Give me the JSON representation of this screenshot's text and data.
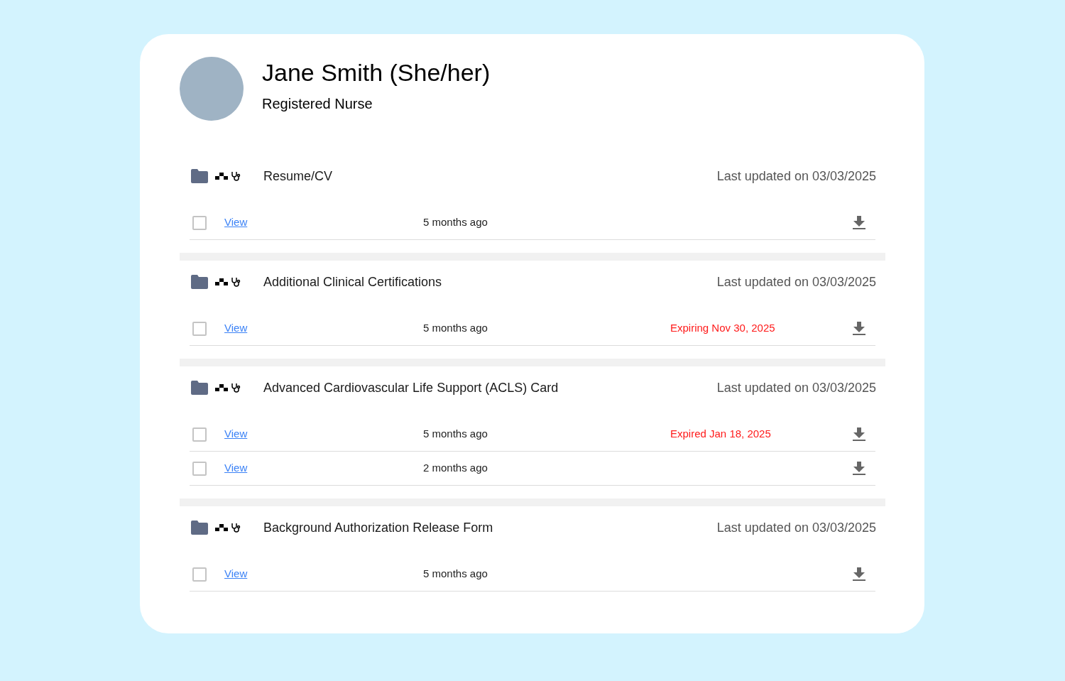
{
  "profile": {
    "name": "Jane Smith (She/her)",
    "title": "Registered Nurse"
  },
  "sections": [
    {
      "title": "Resume/CV",
      "updated": "Last updated on 03/03/2025",
      "files": [
        {
          "checked": false,
          "link": "View",
          "age": "5 months ago"
        }
      ]
    },
    {
      "title": "Additional Clinical Certifications",
      "updated": "Last updated on 03/03/2025",
      "files": [
        {
          "checked": false,
          "link": "View",
          "age": "5 months ago",
          "status": "Expiring Nov 30, 2025"
        }
      ]
    },
    {
      "title": "Advanced Cardiovascular Life Support (ACLS) Card",
      "updated": "Last updated on 03/03/2025",
      "files": [
        {
          "checked": false,
          "link": "View",
          "age": "5 months ago",
          "status": "Expired Jan 18, 2025"
        },
        {
          "checked": false,
          "link": "View",
          "age": "2 months ago"
        }
      ]
    },
    {
      "title": "Background Authorization Release Form",
      "updated": "Last updated on 03/03/2025",
      "files": [
        {
          "checked": false,
          "link": "View",
          "age": "5 months ago"
        }
      ]
    }
  ]
}
